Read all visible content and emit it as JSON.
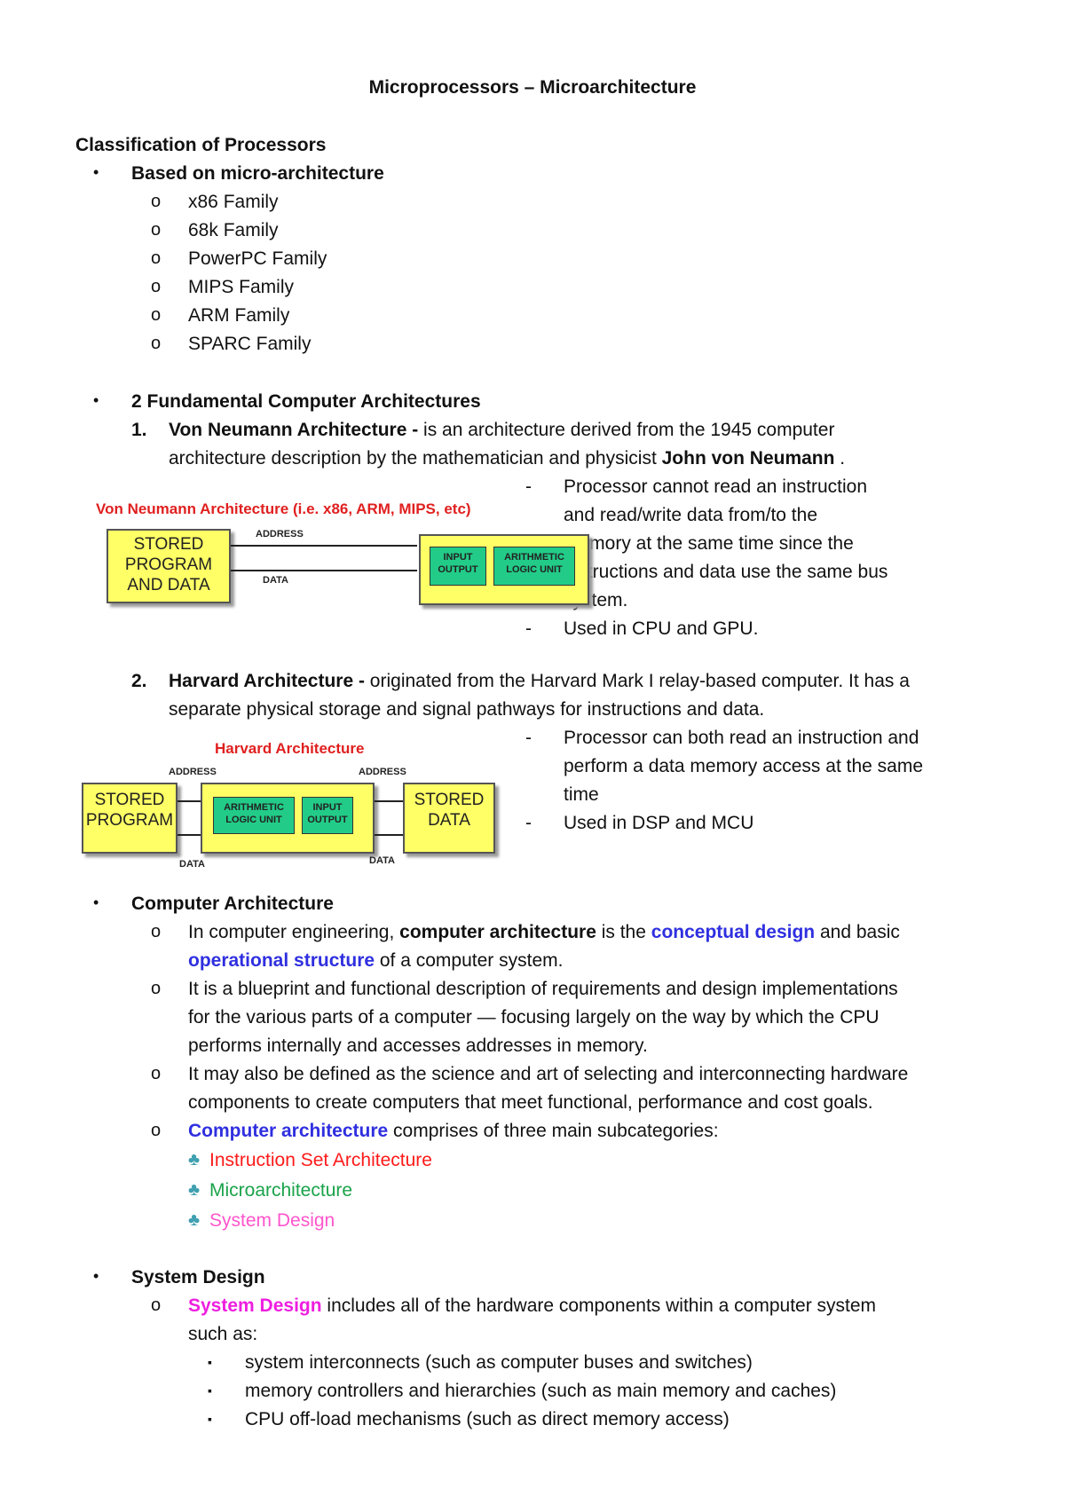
{
  "title": "Microprocessors – Microarchitecture",
  "section_heading": "Classification of Processors",
  "micro_arch": {
    "heading": "Based on micro-architecture",
    "items": [
      "x86 Family",
      "68k Family",
      "PowerPC Family",
      "MIPS Family",
      "ARM Family",
      "SPARC Family"
    ]
  },
  "fundamental": {
    "heading": "2 Fundamental Computer Architectures",
    "von_neumann": {
      "num": "1.",
      "name": "Von Neumann Architecture -",
      "desc_line1": " is an architecture derived from the 1945 computer",
      "desc_line2a": "architecture description by the mathematician and physicist ",
      "desc_line2b": "John von Neumann",
      "desc_line2c": " .",
      "points": [
        [
          "Processor cannot read an instruction",
          "and read/write data from/to the",
          "memory at the same time since the",
          "instructions and data use the same bus",
          "system."
        ],
        [
          "Used in CPU and GPU."
        ]
      ],
      "diagram": {
        "title": "Von Neumann Architecture (i.e. x86, ARM, MIPS, etc)",
        "stored": [
          "STORED",
          "PROGRAM",
          "AND DATA"
        ],
        "address": "ADDRESS",
        "data": "DATA",
        "io": [
          "INPUT",
          "OUTPUT"
        ],
        "alu": [
          "ARITHMETIC",
          "LOGIC UNIT"
        ]
      }
    },
    "harvard": {
      "num": "2.",
      "name": "Harvard Architecture -",
      "desc_line1": " originated from the Harvard Mark I relay-based computer. It has a",
      "desc_line2": "separate physical storage and signal pathways for instructions and data.",
      "points": [
        [
          "Processor can both read an instruction and",
          "perform a data memory access at the same",
          "time"
        ],
        [
          "Used in DSP and MCU"
        ]
      ],
      "diagram": {
        "title": "Harvard Architecture",
        "stored_program": [
          "STORED",
          "PROGRAM"
        ],
        "stored_data": [
          "STORED",
          "DATA"
        ],
        "address_left": "ADDRESS",
        "address_right": "ADDRESS",
        "data_left": "DATA",
        "data_right": "DATA",
        "alu": [
          "ARITHMETIC",
          "LOGIC UNIT"
        ],
        "io": [
          "INPUT",
          "OUTPUT"
        ]
      }
    }
  },
  "computer_arch": {
    "heading": "Computer Architecture",
    "p1": {
      "a": "In computer engineering, ",
      "b": "computer architecture",
      "c": " is the ",
      "d": "conceptual design",
      "e": " and basic",
      "f": "operational structure",
      "g": " of a computer system."
    },
    "p2": [
      "It is a blueprint and functional description of requirements and design implementations",
      "for the various parts of a computer — focusing largely on the way by which the CPU",
      "performs internally and accesses addresses in memory."
    ],
    "p3": [
      "It may also be defined as the science and art of selecting and interconnecting hardware",
      "components to create computers that meet functional, performance and cost goals."
    ],
    "p4": {
      "a": "Computer architecture",
      "b": " comprises of three main subcategories:"
    },
    "subcategories": [
      {
        "label": "Instruction Set Architecture",
        "color": "#ff1a1a"
      },
      {
        "label": "Microarchitecture",
        "color": "#1aa34a"
      },
      {
        "label": "System Design",
        "color": "#ff55cc"
      }
    ],
    "club_color": "#3fa0b0"
  },
  "system_design": {
    "heading": "System Design",
    "p1": {
      "a": "System Design",
      "b": " includes all of the hardware components within a computer system",
      "c": "such as:"
    },
    "items": [
      "system interconnects (such as computer buses and switches)",
      "memory controllers and hierarchies (such as main memory and caches)",
      "CPU off-load mechanisms (such as direct memory access)"
    ]
  },
  "glyphs": {
    "bullet": "•",
    "circle": "o",
    "dash": "-",
    "club": "♣",
    "square": "▪"
  }
}
